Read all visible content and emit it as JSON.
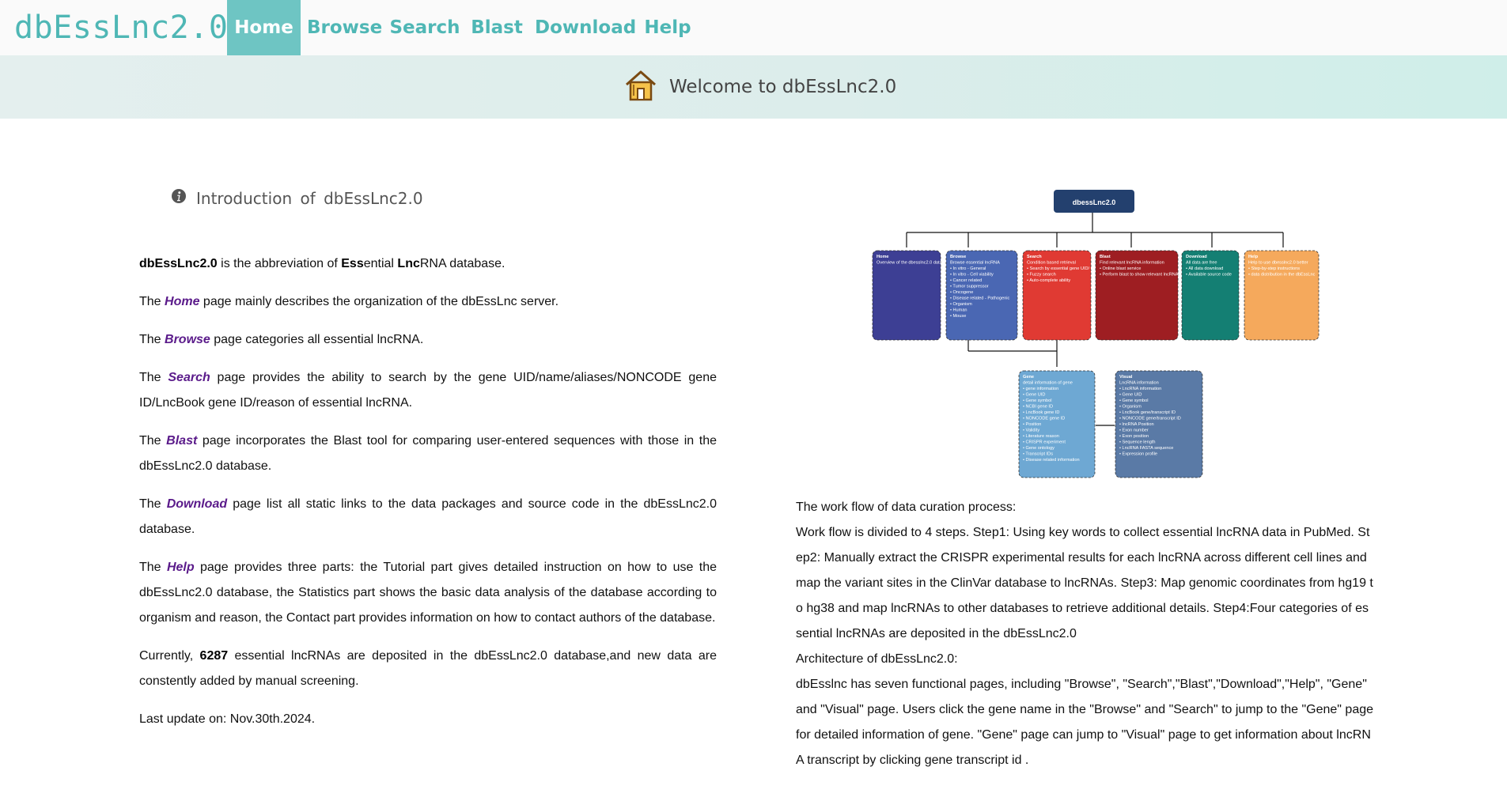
{
  "brand": "dbEssLnc2.0",
  "nav": [
    {
      "label": "Home",
      "active": true
    },
    {
      "label": "Browse"
    },
    {
      "label": "Search"
    },
    {
      "label": "Blast"
    },
    {
      "label": "Download"
    },
    {
      "label": "Help"
    }
  ],
  "banner": {
    "title": "Welcome to dbEssLnc2.0",
    "icon": "home-icon"
  },
  "intro": {
    "heading": "Introduction  of  dbEssLnc2.0",
    "p1": {
      "name": "dbEssLnc2.0",
      "t1": " is the abbreviation of ",
      "ess": "Ess",
      "t2": "ential ",
      "lnc": "Lnc",
      "t3": "RNA database."
    },
    "p2": {
      "pre": "The ",
      "page": "Home",
      "post": " page mainly describes the organization of the dbEssLnc server."
    },
    "p3": {
      "pre": "The ",
      "page": "Browse",
      "post": " page categories all essential lncRNA."
    },
    "p4": {
      "pre": "The ",
      "page": "Search",
      "post": " page provides the ability to search by the gene UID/name/aliases/NONCODE gene ID/LncBook gene ID/reason of essential lncRNA."
    },
    "p5": {
      "pre": "The ",
      "page": "Blast",
      "post": " page incorporates the Blast tool for comparing user-entered sequences with those in the dbEssLnc2.0 database."
    },
    "p6": {
      "pre": "The ",
      "page": "Download",
      "post": " page list all static links to the data packages and source code in the dbEssLnc2.0 database."
    },
    "p7": {
      "pre": "The ",
      "page": "Help",
      "post": " page provides three parts: the Tutorial part gives detailed instruction on how to use the dbEssLnc2.0 database, the Statistics part shows the basic data analysis of the database according to organism and reason, the Contact part provides information on how to contact authors of the database."
    },
    "p8": {
      "pre": "Currently, ",
      "count": "6287",
      "post": " essential lncRNAs are deposited in the dbEssLnc2.0 database,and new data are constently added by manual screening."
    },
    "p9": "Last update on: Nov.30th.2024."
  },
  "right": {
    "l1": "The work flow of data curation process:",
    "l2": "Work flow is divided to 4 steps. Step1: Using key words to collect essential lncRNA data in PubMed. Step2: Manually extract the CRISPR experimental results for each lncRNA across different cell lines and map the variant sites in the ClinVar database to lncRNAs. Step3: Map genomic coordinates from hg19 to hg38 and map lncRNAs to other databases to retrieve additional details. Step4:Four categories of essential lncRNAs are deposited in the dbEssLnc2.0",
    "l3": "Architecture of dbEssLnc2.0:",
    "l4": "dbEsslnc has seven functional pages, including \"Browse\", \"Search\",\"Blast\",\"Download\",\"Help\", \"Gene\" and \"Visual\" page. Users click the gene name in the \"Browse\" and \"Search\" to jump to the \"Gene\" page for detailed information of gene. \"Gene\" page can jump to \"Visual\" page to get information about lncRNA transcript by clicking gene transcript id ."
  },
  "diagram": {
    "root": "dbessLnc2.0",
    "boxes": [
      {
        "id": "home",
        "title": "Home",
        "sub": "Overview of the dbesslnc2.0 database",
        "items": [],
        "color": "#3d3f94"
      },
      {
        "id": "browse",
        "title": "Browse",
        "sub": "Browse essential lncRNA",
        "items": [
          "In vitro - General",
          "In vitro - Cell viability",
          "Cancer related",
          "Tumor suppressor",
          "Oncogene",
          "Disease related - Pathogenic",
          "Organism",
          "Human",
          "Mouse"
        ],
        "color": "#4a67b3"
      },
      {
        "id": "search",
        "title": "Search",
        "sub": "Condition based retrieval",
        "items": [
          "Search by essential gene UID/ name/ LncBook gene ID/Alias/ Reason description",
          "Fuzzy search",
          "Auto-complete ability"
        ],
        "color": "#e03a33"
      },
      {
        "id": "blast",
        "title": "Blast",
        "sub": "Find relevant lncRNA information",
        "items": [
          "Online blast service",
          "Perform blast to show relevant lncRNA information"
        ],
        "color": "#9e1e22"
      },
      {
        "id": "download",
        "title": "Download",
        "sub": "All data are free",
        "items": [
          "All data download",
          "Available source code"
        ],
        "color": "#147f73"
      },
      {
        "id": "help",
        "title": "Help",
        "sub": "Help to use dbesslnc2.0 better",
        "items": [
          "Step-by-step instructions",
          "data distribution in the dbEssLnc"
        ],
        "color": "#f5a95c"
      },
      {
        "id": "gene",
        "title": "Gene",
        "sub": "detail information of gene",
        "items": [
          "gene information",
          "Gene UID",
          "Gene symbol",
          "NCBI gene ID",
          "LncBook gene ID",
          "NONCODE gene ID",
          "Position",
          "Validity",
          "Literature reason",
          "CRISPR experiment",
          "Gene ontology",
          "Transcript IDs",
          "Disease related information"
        ],
        "color": "#6ea8d3"
      },
      {
        "id": "visual",
        "title": "Visual",
        "sub": "LncRNA information",
        "items": [
          "LncRNA information",
          "Gene UID",
          "Gene symbol",
          "Organism",
          "LncBook gene/transcript ID",
          "NONCODE gene/transcript ID",
          "lncRNA Position",
          "Exon number",
          "Exon position",
          "Sequence length",
          "LncRNA FASTA sequence",
          "Expression profile"
        ],
        "color": "#5a7aa6"
      }
    ]
  }
}
